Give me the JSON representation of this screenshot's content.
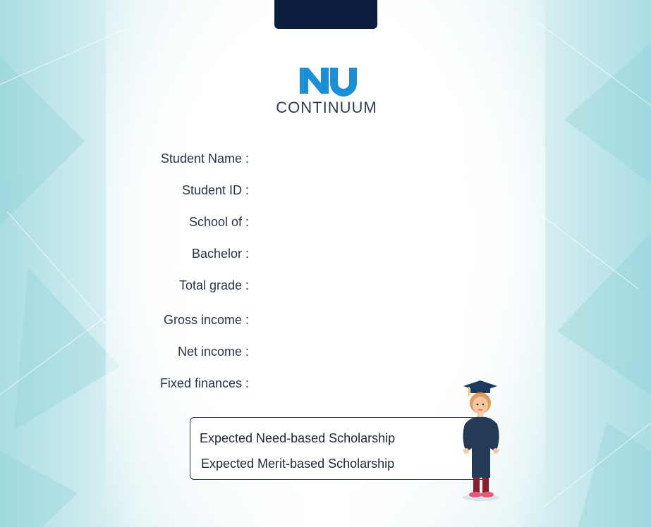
{
  "top_button": {
    "label": ""
  },
  "logo": {
    "word": "CONTINUUM"
  },
  "fields": [
    {
      "label": "Student Name :",
      "value": ""
    },
    {
      "label": "Student ID :",
      "value": ""
    },
    {
      "label": "School of :",
      "value": ""
    },
    {
      "label": "Bachelor :",
      "value": ""
    },
    {
      "label": "Total grade :",
      "value": ""
    },
    {
      "label": "Gross income :",
      "value": ""
    },
    {
      "label": "Net income :",
      "value": ""
    },
    {
      "label": "Fixed finances :",
      "value": ""
    }
  ],
  "results": {
    "need_based": "Expected Need-based Scholarship",
    "merit_based": "Expected Merit-based Scholarship"
  },
  "colors": {
    "navy": "#0b1e3f",
    "logo_blue": "#1a8fd6",
    "text": "#2b3344",
    "bg_teal": "#bfe6ea"
  },
  "icons": {
    "mascot": "graduate-student-icon",
    "logo": "nu-logo-icon"
  }
}
